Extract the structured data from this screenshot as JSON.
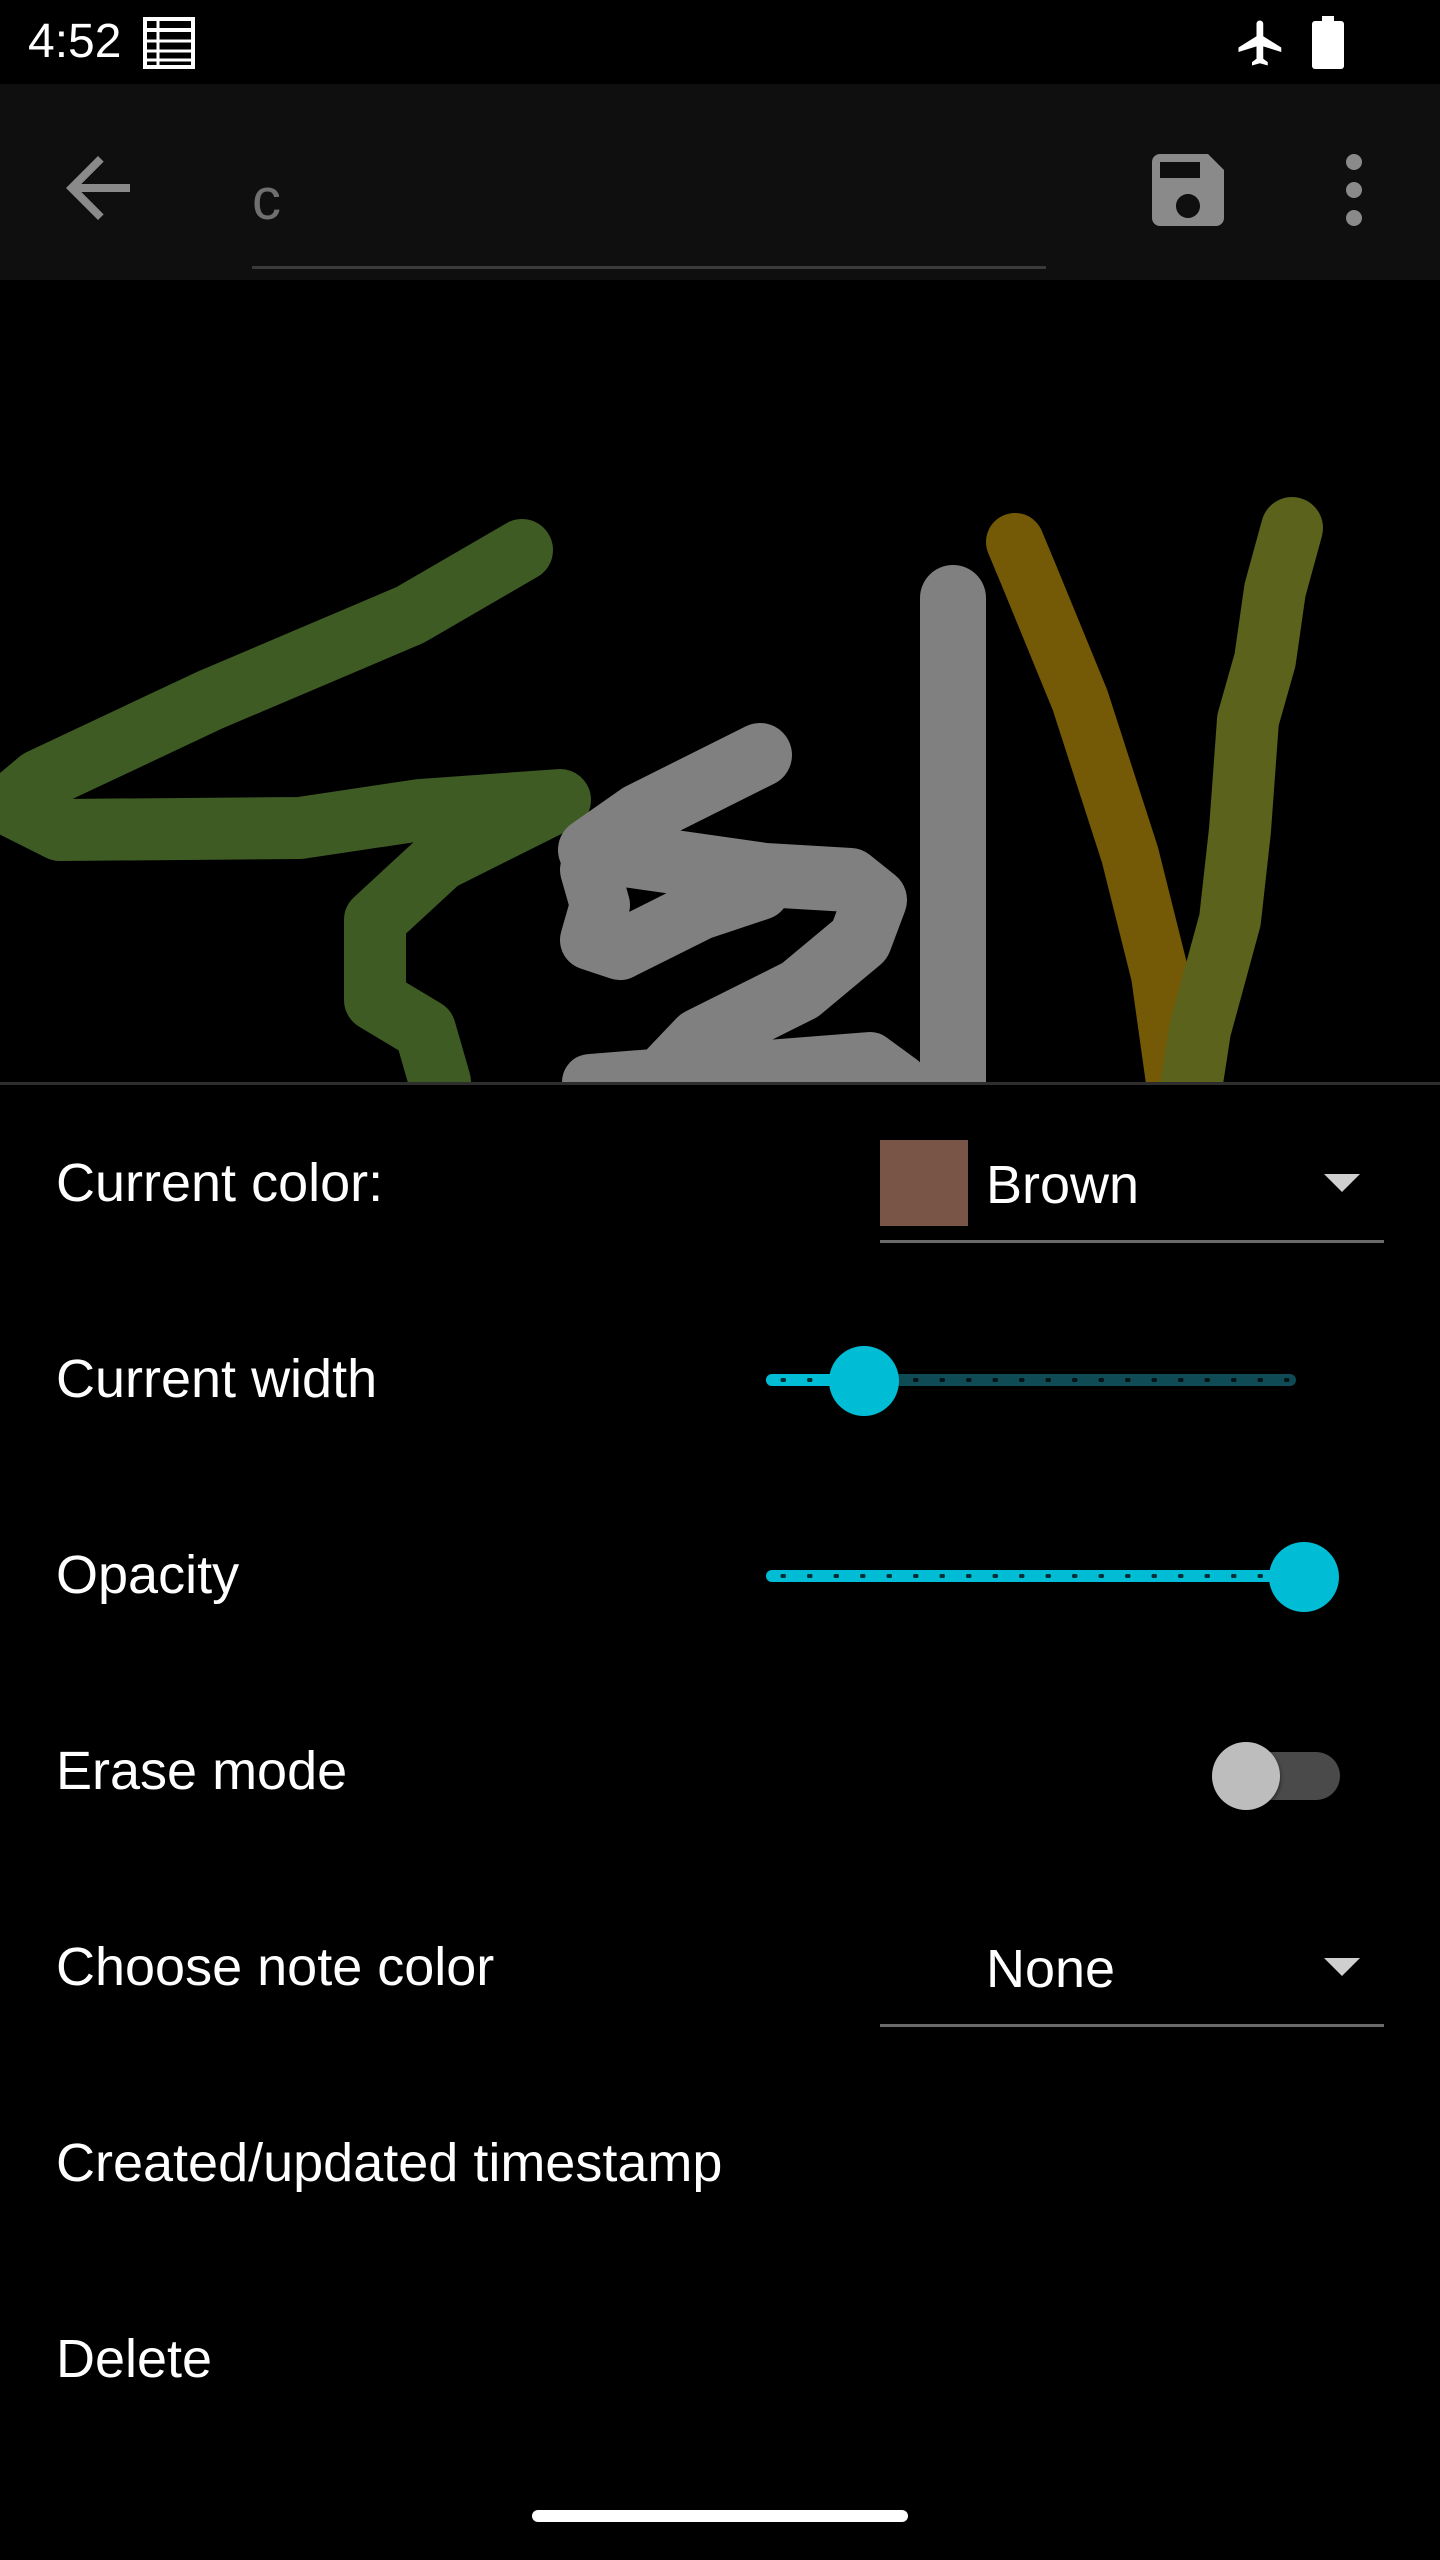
{
  "status_bar": {
    "time": "4:52",
    "icons": [
      "notes-icon",
      "airplane-mode-icon",
      "battery-full-icon"
    ]
  },
  "app_bar": {
    "title_value": "",
    "title_placeholder": "c",
    "icons": [
      "back-arrow-icon",
      "save-floppy-icon",
      "more-vert-icon"
    ]
  },
  "canvas": {
    "stroke_colors": [
      "#3f5b24",
      "#808080",
      "#745a06",
      "#5b621c"
    ]
  },
  "settings": {
    "current_color": {
      "label": "Current color:",
      "value": "Brown",
      "swatch": "#795548"
    },
    "current_width": {
      "label": "Current width",
      "level": 0.15
    },
    "opacity": {
      "label": "Opacity",
      "level": 1.0
    },
    "erase_mode": {
      "label": "Erase mode",
      "enabled": false
    },
    "note_color": {
      "label": "Choose note color",
      "value": "None"
    },
    "timestamp": {
      "label": "Created/updated timestamp"
    },
    "delete": {
      "label": "Delete"
    }
  },
  "colors": {
    "accent": "#00bcd4",
    "background": "#000000",
    "app_bar": "#0f0f0f"
  }
}
